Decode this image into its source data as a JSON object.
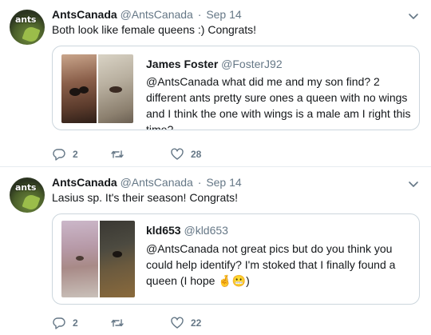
{
  "tweets": [
    {
      "avatar_text": "ants",
      "display_name": "AntsCanada",
      "handle": "@AntsCanada",
      "dot": "·",
      "time": "Sep 14",
      "text": "Both look like female queens :) Congrats!",
      "quote": {
        "display_name": "James Foster",
        "handle": "@FosterJ92",
        "text": "@AntsCanada what did me and my son find? 2 different ants pretty sure ones a queen with no wings and I think the one with wings is a male am I right this time?"
      },
      "actions": {
        "reply_count": "2",
        "retweet_count": "",
        "like_count": "28"
      }
    },
    {
      "avatar_text": "ants",
      "display_name": "AntsCanada",
      "handle": "@AntsCanada",
      "dot": "·",
      "time": "Sep 14",
      "text": "Lasius sp. It's their season! Congrats!",
      "quote": {
        "display_name": "kld653",
        "handle": "@kld653",
        "text": "@AntsCanada not great pics but do you think you could help identify? I'm stoked that I finally found a queen (I hope 🤞😬)"
      },
      "actions": {
        "reply_count": "2",
        "retweet_count": "",
        "like_count": "22"
      }
    }
  ],
  "icons": {
    "reply": "reply-icon",
    "retweet": "retweet-icon",
    "like": "like-icon",
    "caret": "chevron-down-icon"
  },
  "colors": {
    "secondary_text": "#657786",
    "border": "#ccd6dd",
    "divider": "#e6ecf0"
  }
}
